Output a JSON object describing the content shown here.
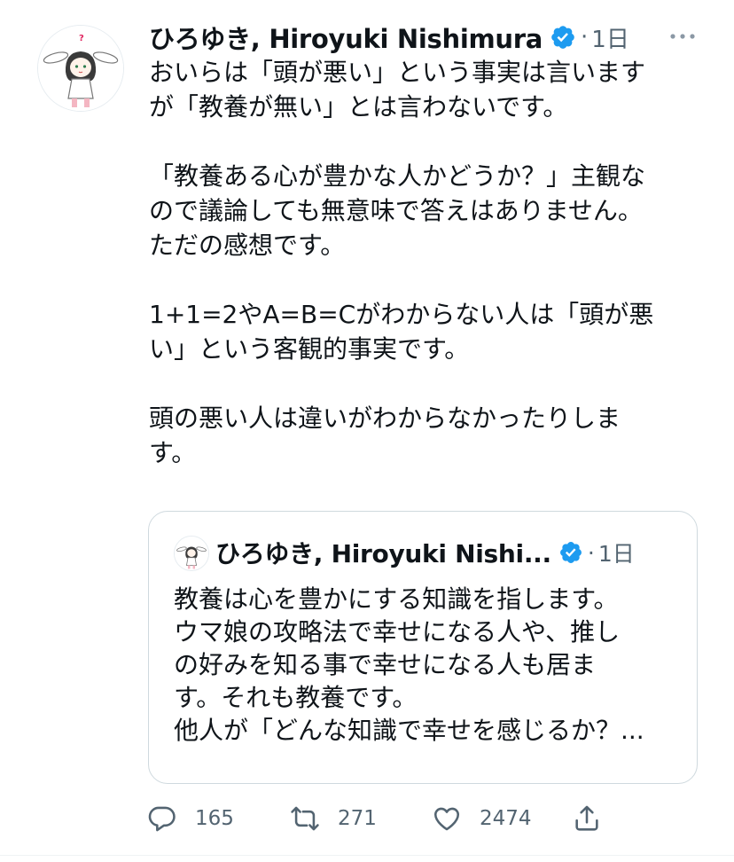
{
  "tweet": {
    "author_name": "ひろゆき, Hiroyuki Nishimura",
    "separator": "·",
    "time": "1日",
    "text": "おいらは「頭が悪い」という事実は言います\nが「教養が無い」とは言わないです。\n\n「教養ある心が豊かな人かどうか？」主観な\nので議論しても無意味で答えはありません。\nただの感想です。\n\n1+1=2やA=B=Cがわからない人は「頭が悪\nい」という客観的事実です。\n\n頭の悪い人は違いがわからなかったりしま\nす。"
  },
  "quoted": {
    "author_name": "ひろゆき, Hiroyuki Nishi...",
    "separator": "·",
    "time": "1日",
    "text": "教養は心を豊かにする知識を指します。\nウマ娘の攻略法で幸せになる人や、推し\nの好みを知る事で幸せになる人も居ま\nす。それも教養です。\n他人が「どんな知識で幸せを感じるか？..."
  },
  "actions": {
    "replies": "165",
    "retweets": "271",
    "likes": "2474"
  },
  "icons": {
    "verified": "verified-badge-icon",
    "more": "more-options-icon",
    "reply": "reply-icon",
    "retweet": "retweet-icon",
    "like": "heart-icon",
    "share": "share-icon"
  },
  "colors": {
    "verified": "#1d9bf0",
    "muted": "#536471",
    "text": "#0f1419",
    "border": "#cfd9de"
  }
}
